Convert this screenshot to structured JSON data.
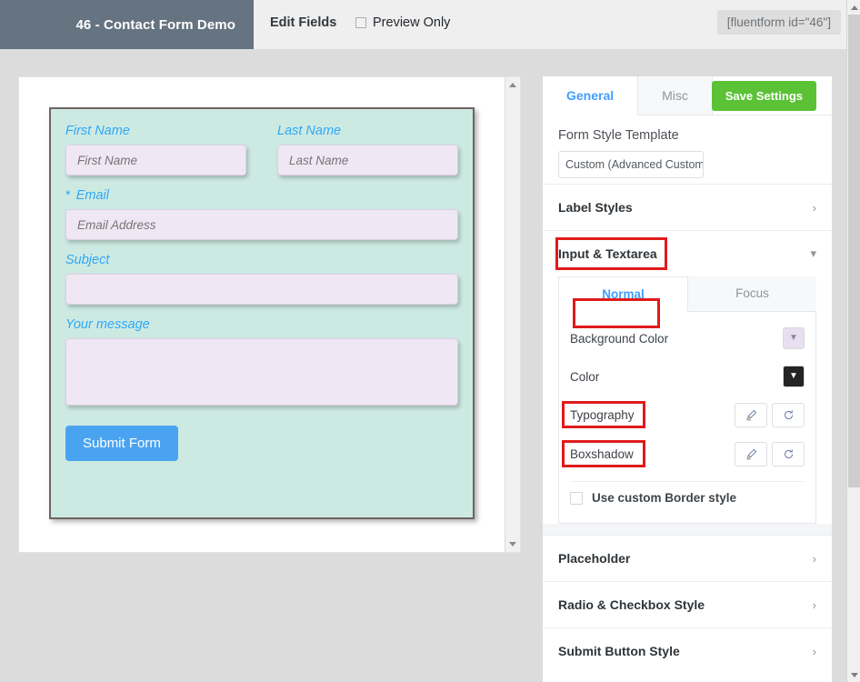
{
  "topbar": {
    "form_title": "46 - Contact Form Demo",
    "edit_fields_label": "Edit Fields",
    "preview_only_label": "Preview Only",
    "preview_only_checked": false,
    "shortcode": "[fluentform id=\"46\"]"
  },
  "form_preview": {
    "background_color": "#CDEAE2",
    "input_background_color": "#F0E7F4",
    "label_color": "#2FA8F7",
    "submit_color": "#4AA3F0",
    "fields": [
      {
        "label": "First Name",
        "placeholder": "First Name",
        "required": false,
        "type": "text"
      },
      {
        "label": "Last Name",
        "placeholder": "Last Name",
        "required": false,
        "type": "text"
      },
      {
        "label": "Email",
        "placeholder": "Email Address",
        "required": true,
        "required_mark": "*",
        "type": "text"
      },
      {
        "label": "Subject",
        "placeholder": "",
        "required": false,
        "type": "text"
      },
      {
        "label": "Your message",
        "placeholder": "",
        "required": false,
        "type": "textarea"
      }
    ],
    "submit_label": "Submit Form"
  },
  "settings": {
    "tabs": [
      {
        "label": "General",
        "active": true
      },
      {
        "label": "Misc",
        "active": false
      }
    ],
    "save_label": "Save Settings",
    "save_color": "#5BC236",
    "template": {
      "label": "Form Style Template",
      "value": "Custom (Advanced Customi"
    },
    "accordions": [
      {
        "label": "Label Styles",
        "expanded": false,
        "chevron": "chevron-right",
        "glyph": "›"
      },
      {
        "label": "Input & Textarea",
        "expanded": true,
        "chevron": "chevron-down",
        "glyph": "⌄",
        "highlighted": true
      },
      {
        "label": "Placeholder",
        "expanded": false,
        "chevron": "chevron-right",
        "glyph": "›"
      },
      {
        "label": "Radio & Checkbox Style",
        "expanded": false,
        "chevron": "chevron-right",
        "glyph": "›"
      },
      {
        "label": "Submit Button Style",
        "expanded": false,
        "chevron": "chevron-right",
        "glyph": "›"
      }
    ],
    "sub_tabs": [
      {
        "label": "Normal",
        "active": true,
        "highlighted": true
      },
      {
        "label": "Focus",
        "active": false,
        "highlighted": false
      }
    ],
    "normal_panel": {
      "rows": [
        {
          "label": "Background Color",
          "control": "color-swatch",
          "value": "#E8E0F0"
        },
        {
          "label": "Color",
          "control": "color-swatch",
          "value": "#242424"
        },
        {
          "label": "Typography",
          "control": "edit-reset",
          "highlighted": true
        },
        {
          "label": "Boxshadow",
          "control": "edit-reset",
          "highlighted": true
        }
      ],
      "border_checkbox_label": "Use custom Border style",
      "border_checkbox_checked": false
    }
  },
  "annotation": {
    "color": "#E01B1B",
    "targets": [
      "Input & Textarea",
      "Normal",
      "Typography",
      "Boxshadow"
    ]
  }
}
